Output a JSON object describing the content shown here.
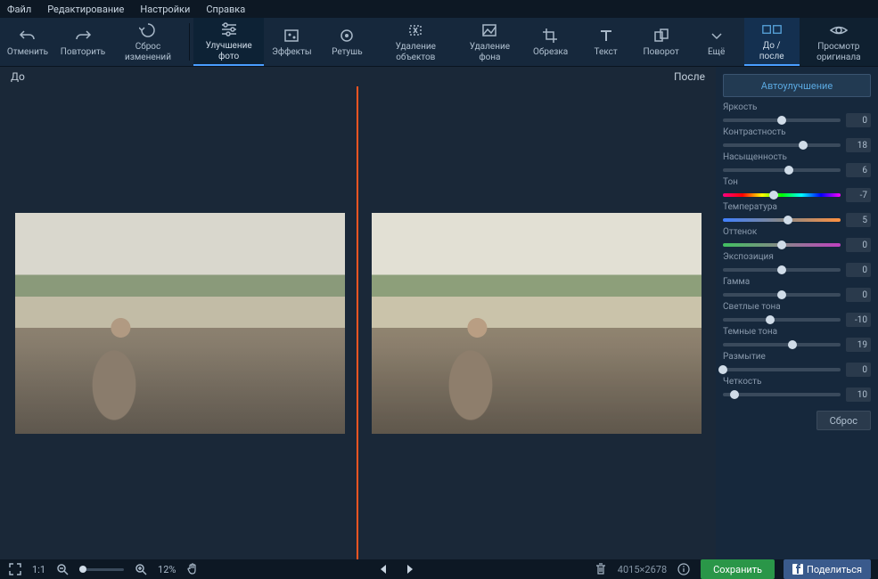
{
  "menubar": [
    "Файл",
    "Редактирование",
    "Настройки",
    "Справка"
  ],
  "toolbar": {
    "undo": "Отменить",
    "redo": "Повторить",
    "reset": "Сброс изменений",
    "enhance": "Улучшение фото",
    "effects": "Эффекты",
    "retouch": "Ретушь",
    "remove_obj": "Удаление объектов",
    "remove_bg": "Удаление фона",
    "crop": "Обрезка",
    "text": "Текст",
    "rotate": "Поворот",
    "more": "Ещё",
    "before_after": "До / после",
    "view_original": "Просмотр оригинала"
  },
  "compare": {
    "before": "До",
    "after": "После"
  },
  "panel": {
    "auto": "Автоулучшение",
    "sliders": [
      {
        "label": "Яркость",
        "value": 0,
        "pos": 50,
        "kind": "plain"
      },
      {
        "label": "Контрастность",
        "value": 18,
        "pos": 68,
        "kind": "plain"
      },
      {
        "label": "Насыщенность",
        "value": 6,
        "pos": 56,
        "kind": "plain"
      },
      {
        "label": "Тон",
        "value": -7,
        "pos": 43,
        "kind": "hue"
      },
      {
        "label": "Температура",
        "value": 5,
        "pos": 55,
        "kind": "temp"
      },
      {
        "label": "Оттенок",
        "value": 0,
        "pos": 50,
        "kind": "tint"
      },
      {
        "label": "Экспозиция",
        "value": 0,
        "pos": 50,
        "kind": "plain"
      },
      {
        "label": "Гамма",
        "value": 0,
        "pos": 50,
        "kind": "plain"
      },
      {
        "label": "Светлые тона",
        "value": -10,
        "pos": 40,
        "kind": "plain"
      },
      {
        "label": "Темные тона",
        "value": 19,
        "pos": 59,
        "kind": "plain"
      },
      {
        "label": "Размытие",
        "value": 0,
        "pos": 0,
        "kind": "plain"
      },
      {
        "label": "Четкость",
        "value": 10,
        "pos": 10,
        "kind": "plain"
      }
    ],
    "reset": "Сброс"
  },
  "footer": {
    "fit_label": "1:1",
    "zoom": "12%",
    "dimensions": "4015×2678",
    "save": "Сохранить",
    "share": "Поделиться"
  }
}
